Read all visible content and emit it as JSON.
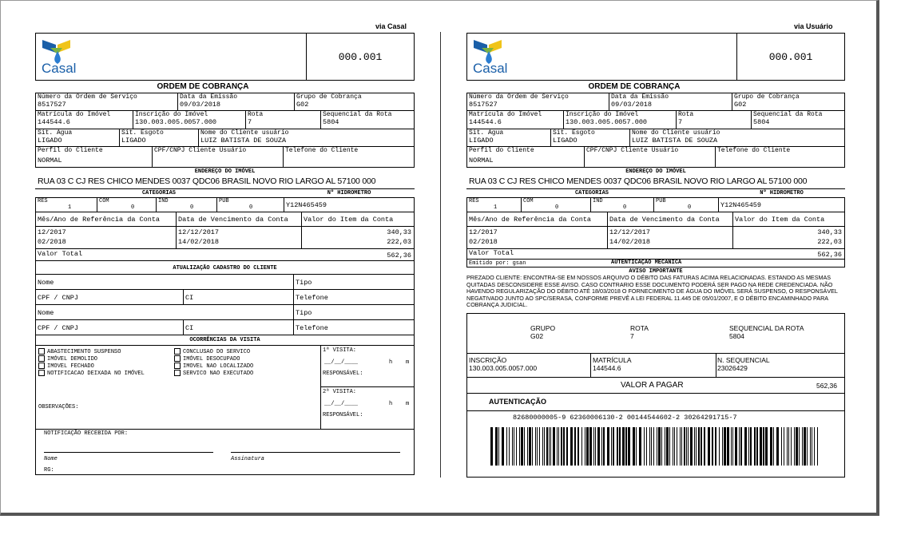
{
  "left": {
    "via": "via Casal",
    "logo_text": "Casal",
    "doc_number": "000.001",
    "title": "ORDEM DE COBRANÇA",
    "fields": {
      "ordem_label": "Número da Ordem de Serviço",
      "ordem_value": "8517527",
      "emissao_label": "Data da Emissão",
      "emissao_value": "09/03/2018",
      "grupo_label": "Grupo de Cobrança",
      "grupo_value": "G02",
      "matricula_label": "Matrícula do Imóvel",
      "matricula_value": "144544.6",
      "inscricao_label": "Inscrição do Imóvel",
      "inscricao_value": "130.003.005.0057.000",
      "rota_label": "Rota",
      "rota_value": "7",
      "seq_label": "Sequencial da Rota",
      "seq_value": "5804",
      "agua_label": "Sit. Água",
      "agua_value": "LIGADO",
      "esgoto_label": "Sit. Esgoto",
      "esgoto_value": "LIGADO",
      "cliente_label": "Nome do Cliente usuário",
      "cliente_value": "LUIZ BATISTA DE SOUZA",
      "perfil_label": "Perfil do Cliente",
      "perfil_value": "NORMAL",
      "cpf_label": "CPF/CNPJ Cliente Usuário",
      "tel_label": "Telefone do Cliente",
      "endereco_label": "ENDEREÇO DO IMÓVEL",
      "endereco_value": "RUA 03 C CJ RES CHICO MENDES   0037   QDC06   BRASIL NOVO RIO LARGO AL 57100 000",
      "categorias_label": "CATEGORIAS",
      "hidrometro_label": "Nº HIDROMETRO",
      "hidrometro_value": "Y12N465459",
      "res_label": "RES",
      "res_value": "1",
      "com_label": "COM",
      "com_value": "0",
      "ind_label": "IND",
      "ind_value": "0",
      "pub_label": "PUB",
      "pub_value": "0"
    },
    "items_header": [
      "Mês/Ano de Referência da Conta",
      "Data de Vencimento da Conta",
      "Valor do Item da Conta"
    ],
    "items": [
      {
        "ref": "12/2017",
        "venc": "12/12/2017",
        "valor": "340,33"
      },
      {
        "ref": "02/2018",
        "venc": "14/02/2018",
        "valor": "222,03"
      }
    ],
    "total_label": "Valor Total",
    "total_value": "562,36",
    "cadastro_title": "ATUALIZAÇÃO CADASTRO DO CLIENTE",
    "cad_nome": "Nome",
    "cad_tipo": "Tipo",
    "cad_cpf": "CPF / CNPJ",
    "cad_ci": "CI",
    "cad_tel": "Telefone",
    "ocorrencias_title": "OCORRÊNCIAS DA VISITA",
    "occ_left": [
      "ABASTECIMENTO SUSPENSO",
      "IMÓVEL DEMOLIDO",
      "IMOVEL FECHADO",
      "NOTIFICACAO DEIXADA NO IMÓVEL"
    ],
    "occ_right": [
      "CONCLUSAO DO SERVICO",
      "IMÓVEL DESOCUPADO",
      "IMOVEL NAO LOCALIZADO",
      "SERVICO NAO EXECUTADO"
    ],
    "visita1": "1ª VISITA:",
    "visita2": "2ª VISITA:",
    "date_placeholder": "__/__/____",
    "h_label": "h",
    "m_label": "m",
    "responsavel": "RESPONSÁVEL:",
    "observacoes": "OBSERVAÇÕES:",
    "notificacao": "NOTIFICAÇÃO RECEBIDA POR:",
    "nome_sig": "Nome",
    "assinatura": "Assinatura",
    "rg": "RG:"
  },
  "right": {
    "via": "via Usuário",
    "emitido_label": "Emitido por: gsan",
    "autenticacao_mec": "AUTENTICAÇÃO MECÂNICA",
    "aviso_title": "AVISO IMPORTANTE",
    "aviso_text": "PREZADO CLIENTE: ENCONTRA-SE EM NOSSOS ARQUIVO O DÉBITO DAS FATURAS ACIMA RELACIONADAS. ESTANDO AS MESMAS QUITADAS DESCONSIDERE ESSE AVISO. CASO CONTRARIO ESSE DOCUMENTO PODERÁ SER PAGO NA REDE CREDENCIADA.  NÃO HAVENDO REGULARIZAÇÃO DO DÉBITO ATÉ     18/03/2018  O FORNECIMENTO DE ÁGUA DO IMÓVEL SERÁ SUSPENSO,  O RESPONSÁVEL NEGATIVADO JUNTO AO SPC/SERASA, CONFORME PREVÊ A LEI FEDERAL 11.445 DE 05/01/2007, E O DÉBITO ENCAMINHADO PARA COBRANÇA JUDICIAL.",
    "grupo_label": "GRUPO",
    "grupo_value": "G02",
    "rota_label": "ROTA",
    "rota_value": "7",
    "seq_label": "SEQUENCIAL DA ROTA",
    "seq_value": "5804",
    "inscricao_label": "INSCRIÇÃO",
    "inscricao_value": "130.003.005.0057.000",
    "matricula_label": "MATRÍCULA",
    "matricula_value": "144544.6",
    "nseq_label": "N. SEQUENCIAL",
    "nseq_value": "23026429",
    "valor_label": "VALOR A PAGAR",
    "valor_value": "562,36",
    "autenticacao": "AUTENTICAÇÃO",
    "linha_digitavel": "82680000005-9 62360006130-2 00144544602-2 30264291715-7"
  }
}
